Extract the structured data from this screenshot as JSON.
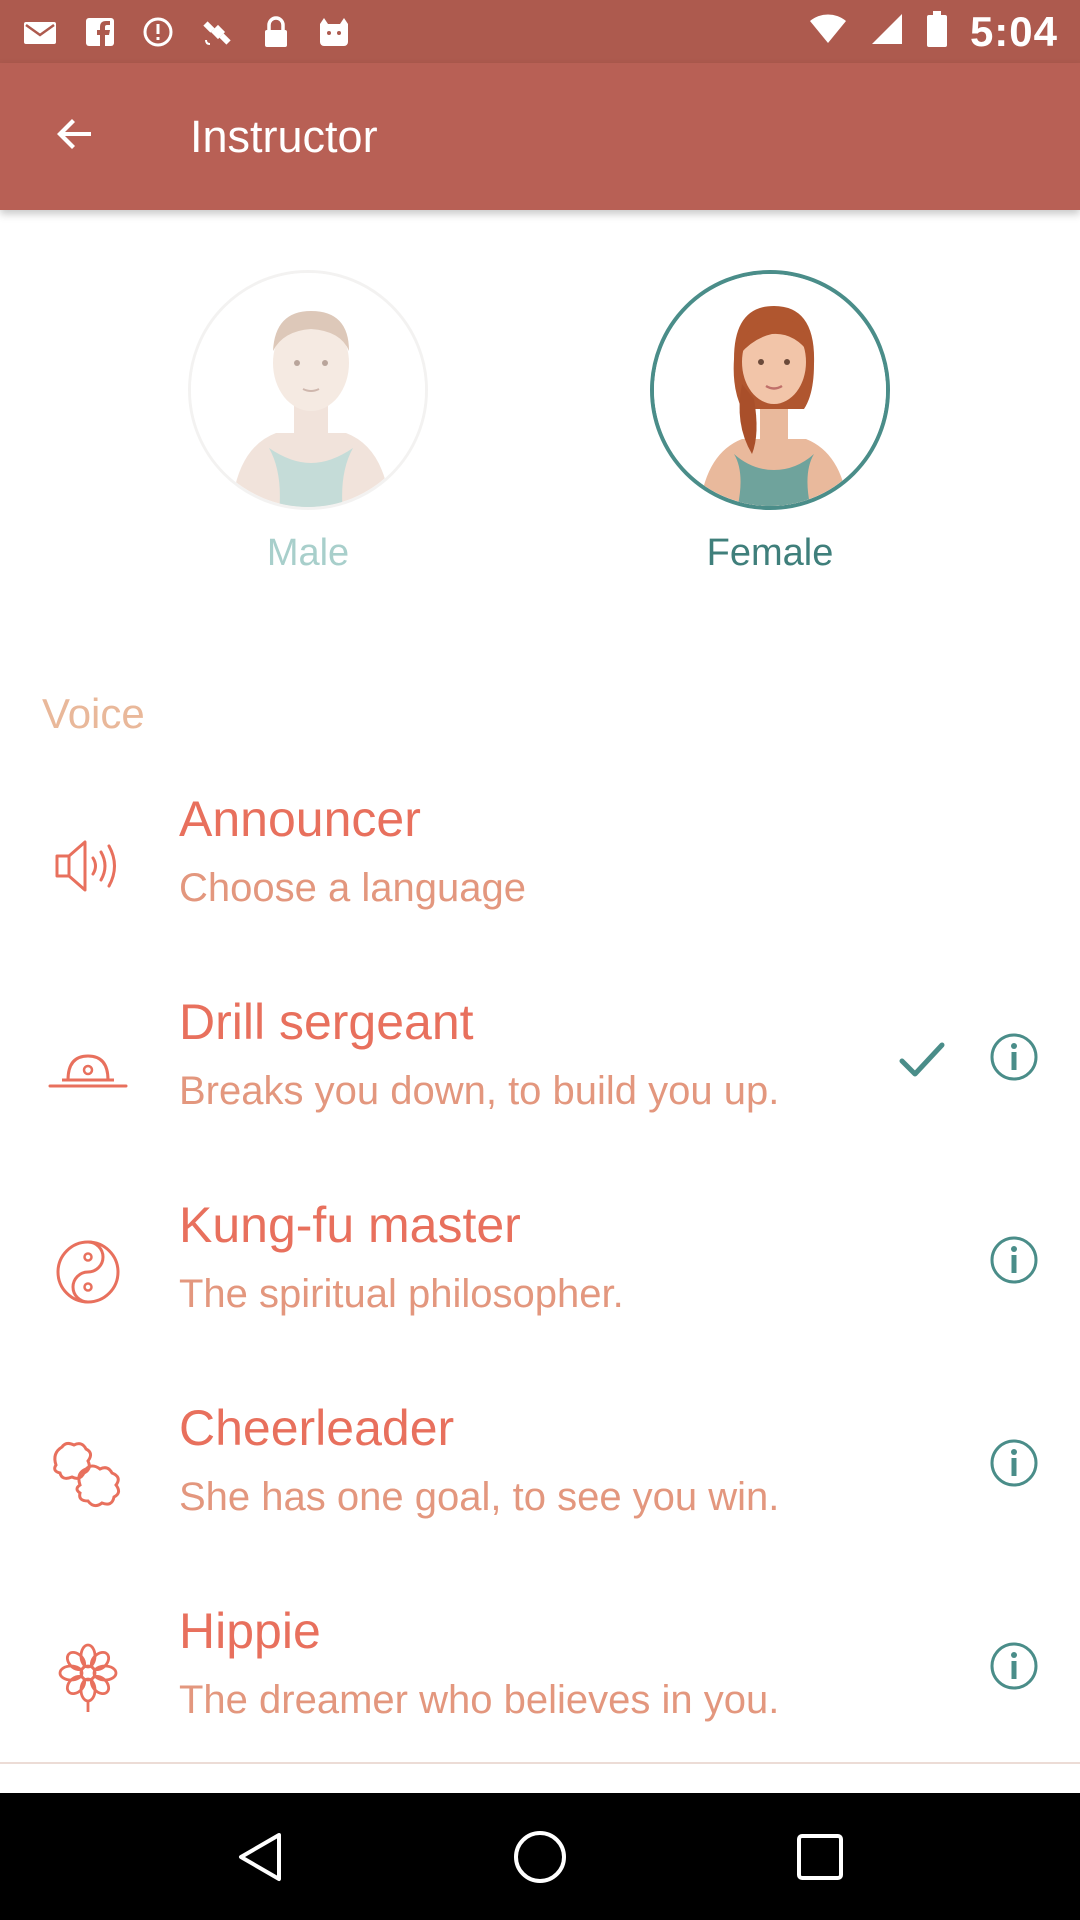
{
  "status_bar": {
    "time": "5:04",
    "icons": [
      "mail-icon",
      "facebook-icon",
      "alert-icon",
      "satellite-icon",
      "lock-icon",
      "cat-icon",
      "wifi-icon",
      "signal-icon",
      "battery-icon"
    ]
  },
  "app_bar": {
    "title": "Instructor",
    "back_icon": "arrow-back-icon"
  },
  "instructors": [
    {
      "label": "Male",
      "selected": false
    },
    {
      "label": "Female",
      "selected": true
    }
  ],
  "voice_section": {
    "title": "Voice",
    "items": [
      {
        "title": "Announcer",
        "subtitle": "Choose a language",
        "icon": "speaker-icon",
        "selected": false,
        "has_info": false
      },
      {
        "title": "Drill sergeant",
        "subtitle": "Breaks you down, to build you up.",
        "icon": "sergeant-hat-icon",
        "selected": true,
        "has_info": true
      },
      {
        "title": "Kung-fu master",
        "subtitle": "The spiritual philosopher.",
        "icon": "yin-yang-icon",
        "selected": false,
        "has_info": true
      },
      {
        "title": "Cheerleader",
        "subtitle": "She has one goal, to see you win.",
        "icon": "pompom-icon",
        "selected": false,
        "has_info": true
      },
      {
        "title": "Hippie",
        "subtitle": "The dreamer who believes in you.",
        "icon": "flower-icon",
        "selected": false,
        "has_info": true
      }
    ]
  },
  "nav_bar": {
    "buttons": [
      "back-nav-icon",
      "home-nav-icon",
      "recents-nav-icon"
    ]
  },
  "colors": {
    "status_bar": "#ad5a4e",
    "app_bar": "#b86055",
    "accent": "#e8705d",
    "teal": "#4a8d89",
    "section_title": "#e9b89a"
  }
}
